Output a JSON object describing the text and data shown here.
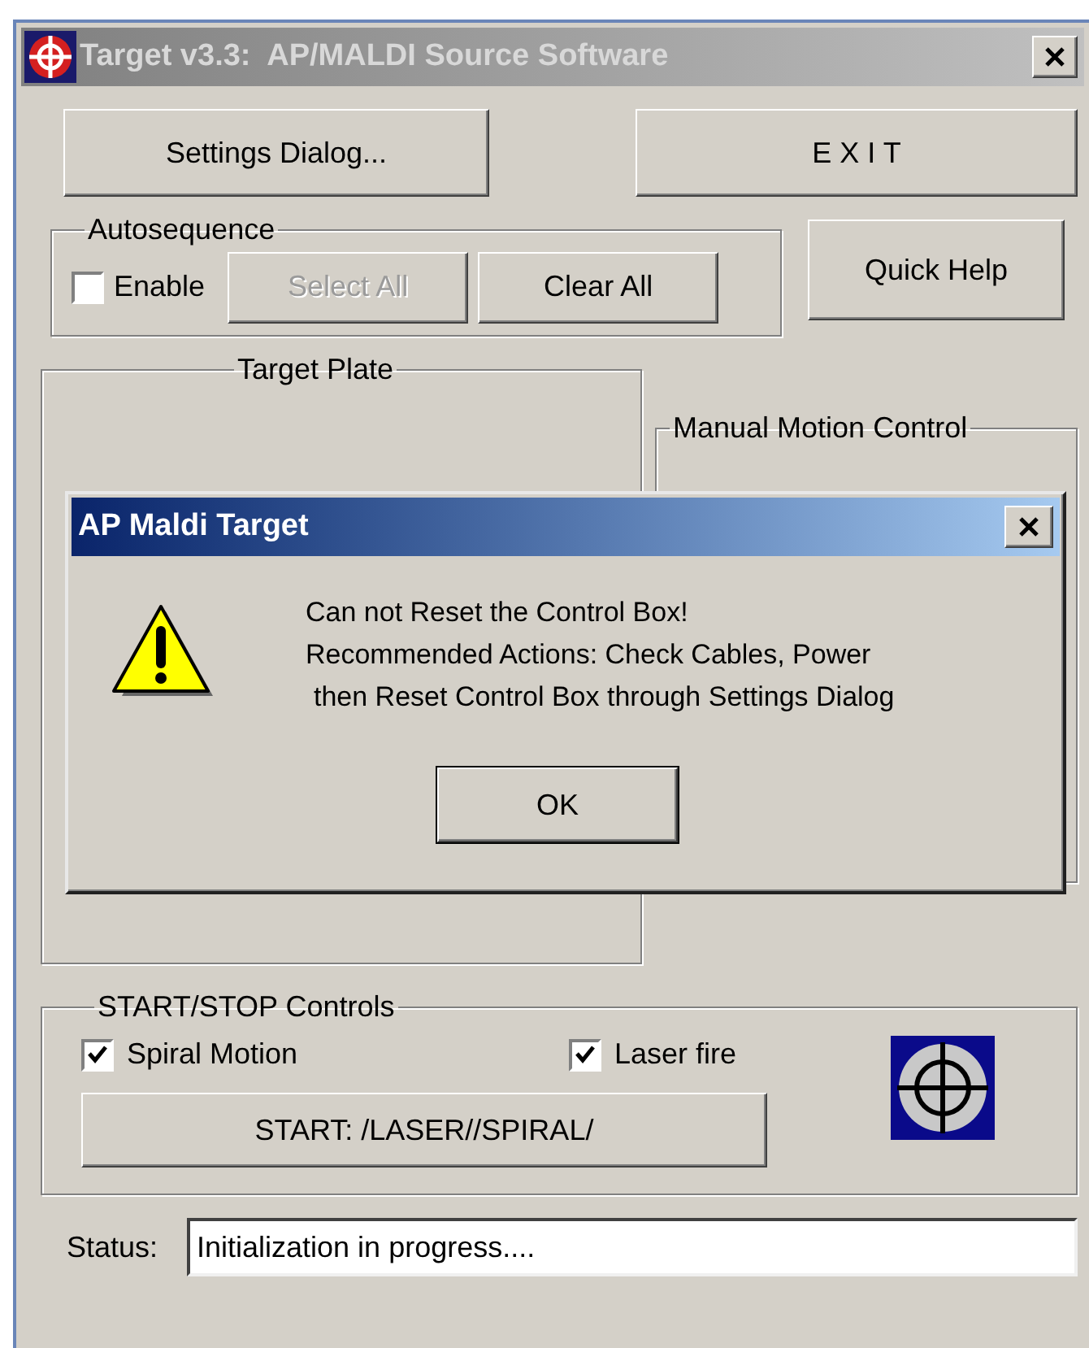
{
  "window": {
    "title": "Target v3.3:  AP/MALDI Source Software"
  },
  "top_buttons": [
    {
      "label": "Settings Dialog..."
    },
    {
      "label": "E X I T"
    }
  ],
  "autosequence": {
    "title": "Autosequence",
    "enable": {
      "label": "Enable",
      "checked": false
    },
    "buttons": [
      {
        "label": "Select All",
        "disabled": true
      },
      {
        "label": "Clear All",
        "disabled": false
      }
    ]
  },
  "quick_help": {
    "label": "Quick Help"
  },
  "target_plate": {
    "title": "Target Plate"
  },
  "manual_motion": {
    "title": "Manual Motion Control"
  },
  "start_stop": {
    "title": "START/STOP Controls",
    "checks": [
      {
        "label": "Spiral Motion",
        "checked": true
      },
      {
        "label": "Laser fire",
        "checked": true
      }
    ],
    "start_button": "START: /LASER//SPIRAL/"
  },
  "status": {
    "label": "Status:",
    "value": "Initialization in progress...."
  },
  "dialog": {
    "title": "AP Maldi Target",
    "lines": [
      "Can not Reset the Control Box!",
      "Recommended Actions: Check Cables, Power",
      "then Reset Control Box through Settings Dialog"
    ],
    "button": "OK"
  }
}
